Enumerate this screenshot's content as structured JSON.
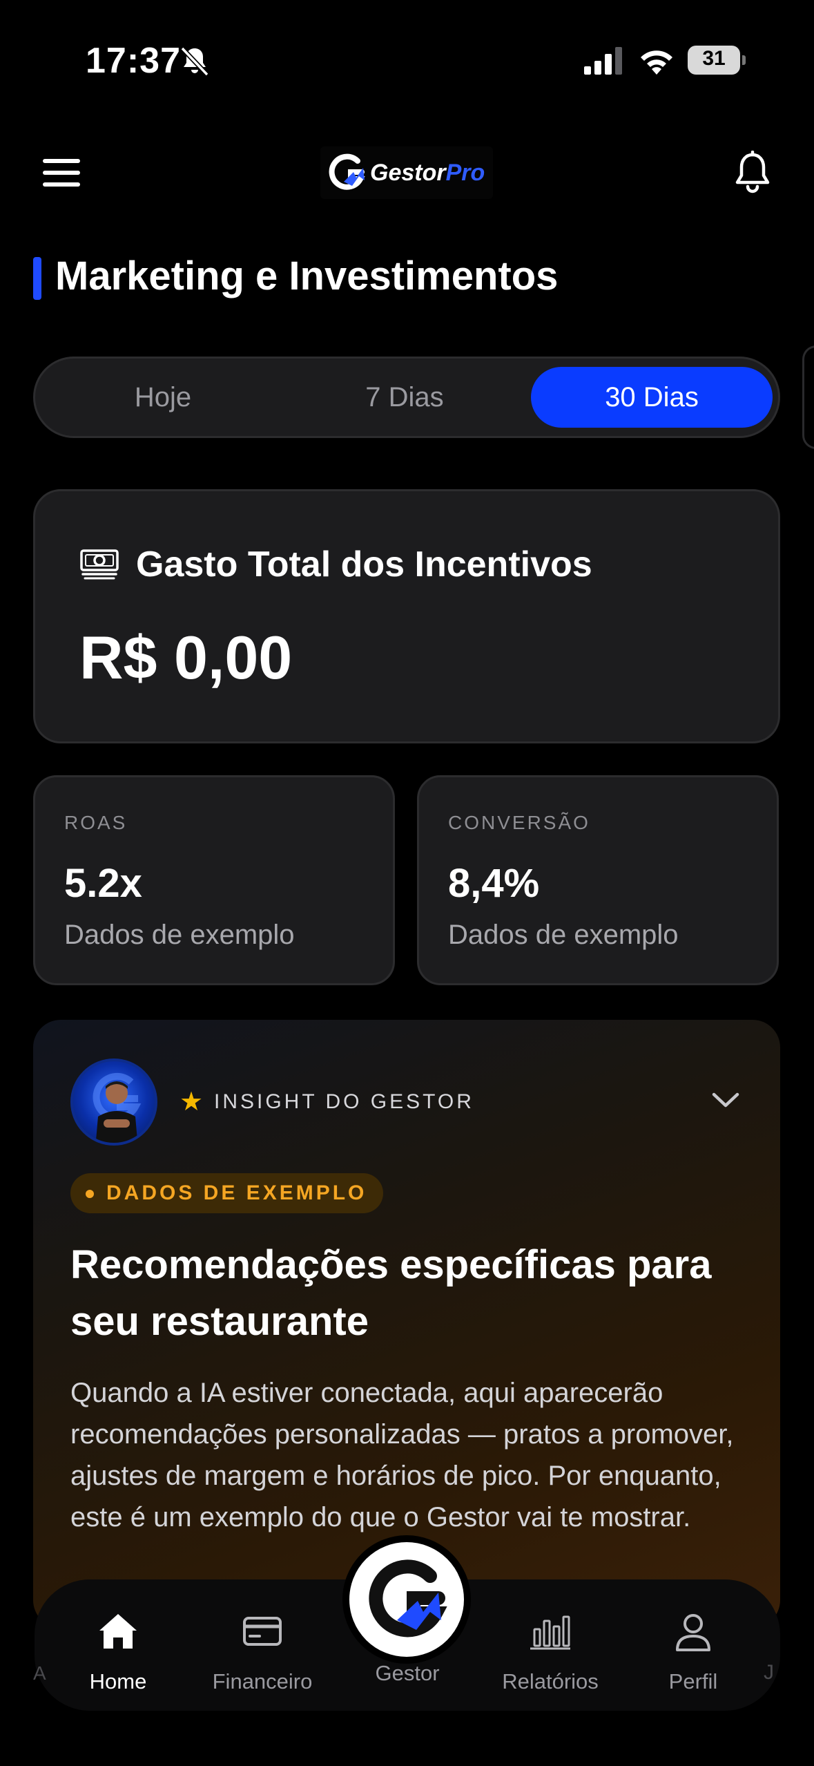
{
  "status_bar": {
    "time": "17:37",
    "battery": "31"
  },
  "header": {
    "logo_main": "Gestor",
    "logo_accent": "Pro"
  },
  "page": {
    "title": "Marketing e Investimentos"
  },
  "period_tabs": [
    {
      "label": "Hoje",
      "selected": false
    },
    {
      "label": "7 Dias",
      "selected": false
    },
    {
      "label": "30 Dias",
      "selected": true
    }
  ],
  "total_card": {
    "label": "Gasto Total dos Incentivos",
    "value": "R$ 0,00"
  },
  "metrics": [
    {
      "label": "ROAS",
      "value": "5.2x",
      "sub": "Dados de exemplo"
    },
    {
      "label": "CONVERSÃO",
      "value": "8,4%",
      "sub": "Dados de exemplo"
    }
  ],
  "insight": {
    "label": "INSIGHT DO GESTOR",
    "badge": "DADOS DE EXEMPLO",
    "title": "Recomendações específicas para seu restaurante",
    "body": "Quando a IA estiver conectada, aqui aparecerão recomendações personalizadas — pratos a promover, ajustes de margem e horários de pico. Por enquanto, este é um exemplo do que o Gestor vai te mostrar."
  },
  "nav": {
    "home": "Home",
    "financeiro": "Financeiro",
    "gestor": "Gestor",
    "relatorios": "Relatórios",
    "perfil": "Perfil",
    "edge_left": "A",
    "edge_right": "J"
  },
  "colors": {
    "accent": "#0a3cff",
    "badge_text": "#f5a623",
    "star": "#f5b800"
  }
}
